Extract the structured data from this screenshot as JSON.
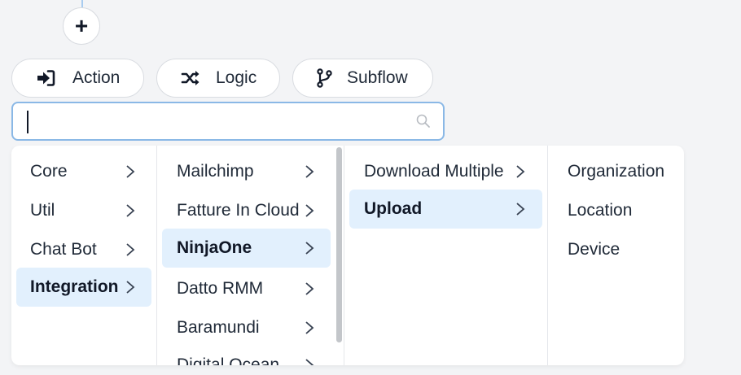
{
  "add_button": {
    "label": "+"
  },
  "toolbar": {
    "action": {
      "label": "Action",
      "icon": "sign-in-arrow-icon"
    },
    "logic": {
      "label": "Logic",
      "icon": "shuffle-icon"
    },
    "subflow": {
      "label": "Subflow",
      "icon": "code-branch-icon"
    }
  },
  "search": {
    "value": "",
    "placeholder": "",
    "icon": "search-icon"
  },
  "menu": {
    "columns": [
      {
        "items": [
          {
            "label": "Core",
            "has_submenu": true,
            "selected": false
          },
          {
            "label": "Util",
            "has_submenu": true,
            "selected": false
          },
          {
            "label": "Chat Bot",
            "has_submenu": true,
            "selected": false
          },
          {
            "label": "Integration",
            "has_submenu": true,
            "selected": true
          }
        ]
      },
      {
        "items": [
          {
            "label": "Mailchimp",
            "has_submenu": true,
            "selected": false
          },
          {
            "label": "Fatture In Cloud",
            "has_submenu": true,
            "selected": false
          },
          {
            "label": "NinjaOne",
            "has_submenu": true,
            "selected": true
          },
          {
            "label": "Datto RMM",
            "has_submenu": true,
            "selected": false
          },
          {
            "label": "Baramundi",
            "has_submenu": true,
            "selected": false
          },
          {
            "label": "Digital Ocean",
            "has_submenu": true,
            "selected": false
          }
        ]
      },
      {
        "items": [
          {
            "label": "Download Multiple",
            "has_submenu": true,
            "selected": false
          },
          {
            "label": "Upload",
            "has_submenu": true,
            "selected": true
          }
        ]
      },
      {
        "items": [
          {
            "label": "Organization",
            "has_submenu": false,
            "selected": false
          },
          {
            "label": "Location",
            "has_submenu": false,
            "selected": false
          },
          {
            "label": "Device",
            "has_submenu": false,
            "selected": false
          }
        ]
      }
    ]
  },
  "colors": {
    "background": "#f3f4f6",
    "selected_bg": "#e2f0fd",
    "focus_border": "#8ab8e6",
    "text": "#1f2937"
  }
}
